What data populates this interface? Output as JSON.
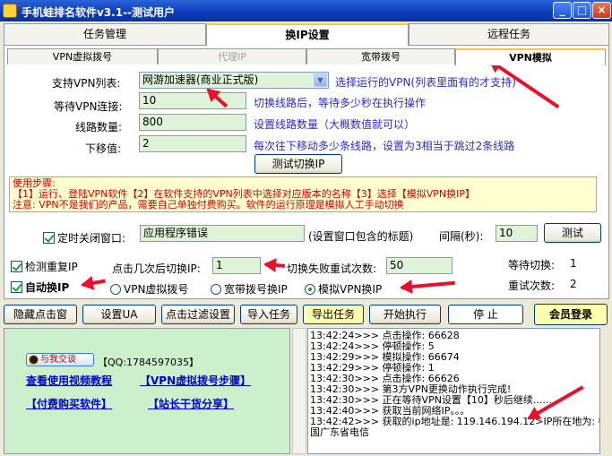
{
  "window": {
    "title": "手机蛙排名软件v3.1--测试用户",
    "minimize": "_",
    "maximize": "□",
    "close": "×"
  },
  "main_tabs": [
    {
      "label": "任务管理"
    },
    {
      "label": "换IP设置"
    },
    {
      "label": "远程任务"
    }
  ],
  "sub_tabs": [
    {
      "label": "VPN虚拟拨号"
    },
    {
      "label": "代理IP"
    },
    {
      "label": "宽带拨号"
    },
    {
      "label": "VPN模拟"
    }
  ],
  "vpn": {
    "list_label": "支持VPN列表:",
    "list_value": "网游加速器(商业正式版)",
    "list_hint": "选择运行的VPN(列表里面有的才支持)",
    "wait_label": "等待VPN连接:",
    "wait_value": "10",
    "wait_hint": "切换线路后，等待多少秒在执行操作",
    "lines_label": "线路数量:",
    "lines_value": "800",
    "lines_hint": "设置线路数量（大概数值就可以）",
    "shift_label": "下移值:",
    "shift_value": "2",
    "shift_hint": "每次往下移动多少条线路，设置为3相当于跳过2条线路",
    "test_button": "测试切换IP"
  },
  "steps": {
    "title": "使用步骤:",
    "line1": "【1】运行、登陆VPN软件【2】在软件支持的VPN列表中选择对应版本的名称【3】选择【模拟VPN换IP】",
    "line2": "注意: VPN不是我们的产品，需要自己单独付费购买。软件的运行原理是模拟人工手动切换"
  },
  "timer": {
    "checkbox_label": "定时关闭窗口:",
    "window_value": "应用程序错误",
    "window_hint": "(设置窗口包含的标题)",
    "interval_label": "间隔(秒):",
    "interval_value": "10",
    "test_button": "测试"
  },
  "options": {
    "detect_dup": "检测重复IP",
    "clicks_label": "点击几次后切换IP:",
    "clicks_value": "1",
    "retry_label": "切换失败重试次数:",
    "retry_value": "50",
    "wait_switch_label": "等待切换:",
    "wait_switch_value": "1",
    "retry_count_label": "重试次数:",
    "retry_count_value": "2",
    "auto_ip": "自动换IP",
    "radio_vpn": "VPN虚拟拨号",
    "radio_broadband": "宽带拨号换IP",
    "radio_simulate": "模拟VPN换IP"
  },
  "toolbar": {
    "hide": "隐藏点击窗",
    "ua": "设置UA",
    "filter": "点击过滤设置",
    "import": "导入任务",
    "export": "导出任务",
    "start": "开始执行",
    "stop": "停 止",
    "login": "会员登录"
  },
  "left": {
    "qq_badge": "与我交谈",
    "qq": "【QQ:1784597035】",
    "link_tutorial": "查看使用视频教程",
    "link_vpn_steps": "【VPN虚拟拨号步骤】",
    "link_buy": "【付费购买软件】",
    "link_share": "【站长干货分享】"
  },
  "log": [
    "13:42:24>>> 点击操作: 66628",
    "13:42:24>>> 停顿操作: 5",
    "13:42:29>>> 模拟操作: 66674",
    "13:42:29>>> 停顿操作: 1",
    "13:42:30>>> 点击操作: 66626",
    "13:42:30>>> 第3方VPN更换动作执行完成!",
    "13:42:30>>> 正在等待VPN设置【10】秒后继续......",
    "13:42:40>>> 获取当前网络IP。。。",
    "13:42:42>>> 获取的ip地址是: 119.146.194.12>IP所在地为: 中",
    "国广东省电信"
  ],
  "colors": {
    "arrow": "#e8102a",
    "accent": "#ffc83c",
    "link": "#0000d0",
    "warning": "#d00000"
  }
}
